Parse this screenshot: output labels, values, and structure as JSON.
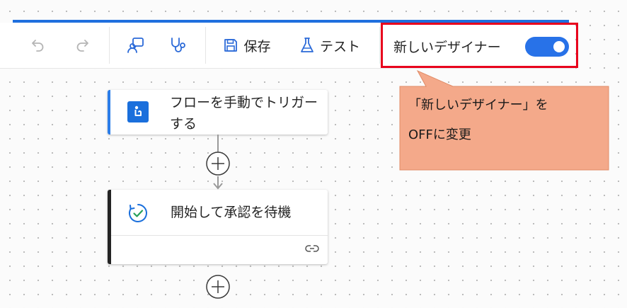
{
  "toolbar": {
    "undo_icon": "undo-icon",
    "redo_icon": "redo-icon",
    "copilot_icon": "copilot-icon",
    "checker_icon": "flow-checker-icon",
    "save_label": "保存",
    "test_label": "テスト",
    "toggle_label": "新しいデザイナー",
    "toggle_state": "on"
  },
  "annotation": {
    "line1": "「新しいデザイナー」を",
    "line2": "OFFに変更"
  },
  "flow": {
    "steps": [
      {
        "title": "フローを手動でトリガーする",
        "icon": "manual-trigger-icon",
        "accent": "#2b7de9"
      },
      {
        "title": "開始して承認を待機",
        "icon": "approval-icon",
        "accent": "#242424"
      }
    ]
  },
  "colors": {
    "accent_blue": "#1f6fde",
    "highlight_red": "#e8001c",
    "callout_fill": "#f4a98a"
  }
}
